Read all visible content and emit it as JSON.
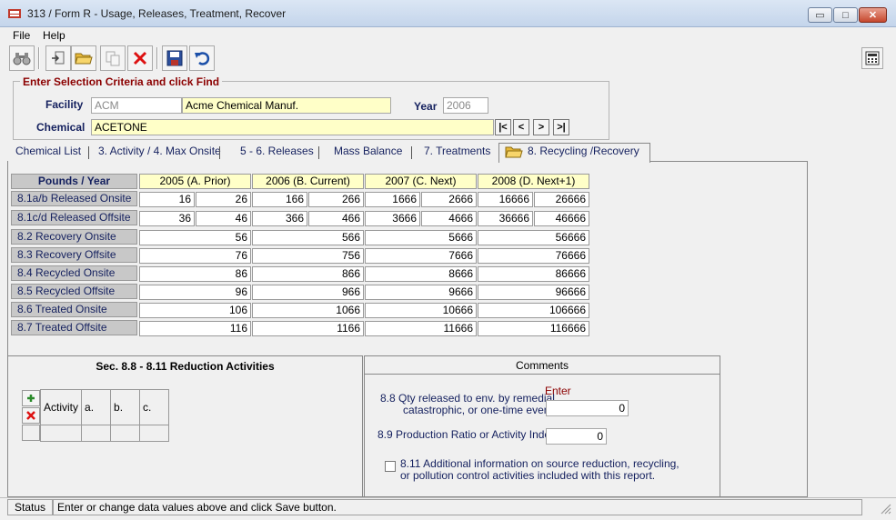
{
  "window": {
    "title": "313 / Form R - Usage, Releases, Treatment, Recover",
    "minimize_label": "▭",
    "maximize_label": "□",
    "close_label": "✕"
  },
  "menu": {
    "file_label": "File",
    "help_label": "Help"
  },
  "toolbar": {
    "icons": [
      "binoculars-icon",
      "exit-document-icon",
      "open-folder-icon",
      "copy-icon",
      "delete-icon",
      "save-disk-icon",
      "undo-icon",
      "calculator-icon"
    ]
  },
  "criteria": {
    "legend": "Enter Selection Criteria and click Find",
    "facility_label": "Facility",
    "facility_code": "ACM",
    "facility_name": "Acme Chemical Manuf.",
    "year_label": "Year",
    "year_value": "2006",
    "chemical_label": "Chemical",
    "chemical_value": "ACETONE",
    "nav": [
      "|<",
      "<",
      ">",
      ">|"
    ]
  },
  "tabs": [
    "Chemical List",
    "3. Activity / 4. Max Onsite",
    "5 - 6. Releases",
    "Mass Balance",
    "7. Treatments",
    "8. Recycling /Recovery"
  ],
  "grid": {
    "corner_label": "Pounds / Year",
    "columns": [
      "2005  (A. Prior)",
      "2006  (B. Current)",
      "2007  (C. Next)",
      "2008  (D. Next+1)"
    ],
    "split_rows": [
      {
        "label": "8.1a/b  Released Onsite",
        "values": [
          "16",
          "26",
          "166",
          "266",
          "1666",
          "2666",
          "16666",
          "26666"
        ]
      },
      {
        "label": "8.1c/d  Released Offsite",
        "values": [
          "36",
          "46",
          "366",
          "466",
          "3666",
          "4666",
          "36666",
          "46666"
        ]
      }
    ],
    "rows": [
      {
        "label": "8.2 Recovery Onsite",
        "values": [
          "56",
          "566",
          "5666",
          "56666"
        ]
      },
      {
        "label": "8.3 Recovery Offsite",
        "values": [
          "76",
          "756",
          "7666",
          "76666"
        ]
      },
      {
        "label": "8.4 Recycled Onsite",
        "values": [
          "86",
          "866",
          "8666",
          "86666"
        ]
      },
      {
        "label": "8.5 Recycled Offsite",
        "values": [
          "96",
          "966",
          "9666",
          "96666"
        ]
      },
      {
        "label": "8.6 Treated Onsite",
        "values": [
          "106",
          "1066",
          "10666",
          "106666"
        ]
      },
      {
        "label": "8.7 Treated Offsite",
        "values": [
          "116",
          "1166",
          "11666",
          "116666"
        ]
      }
    ]
  },
  "reduction": {
    "title": "Sec. 8.8  - 8.11  Reduction Activities",
    "headers": [
      "Activity",
      "a.",
      "b.",
      "c."
    ]
  },
  "comments": {
    "tab_label": "Comments",
    "enter_label": "Enter",
    "q88_line1": "8.8  Qty released to env. by remedial,",
    "q88_line2": "catastrophic, or one-time events",
    "q88_value": "0",
    "q89_label": "8.9  Production Ratio or Activity Index",
    "q89_value": "0",
    "q811_line1": "8.11  Additional information on source reduction, recycling,",
    "q811_line2": "or pollution control activities included with this report."
  },
  "status": {
    "label": "Status",
    "text": "Enter or change data values above and click Save button."
  }
}
